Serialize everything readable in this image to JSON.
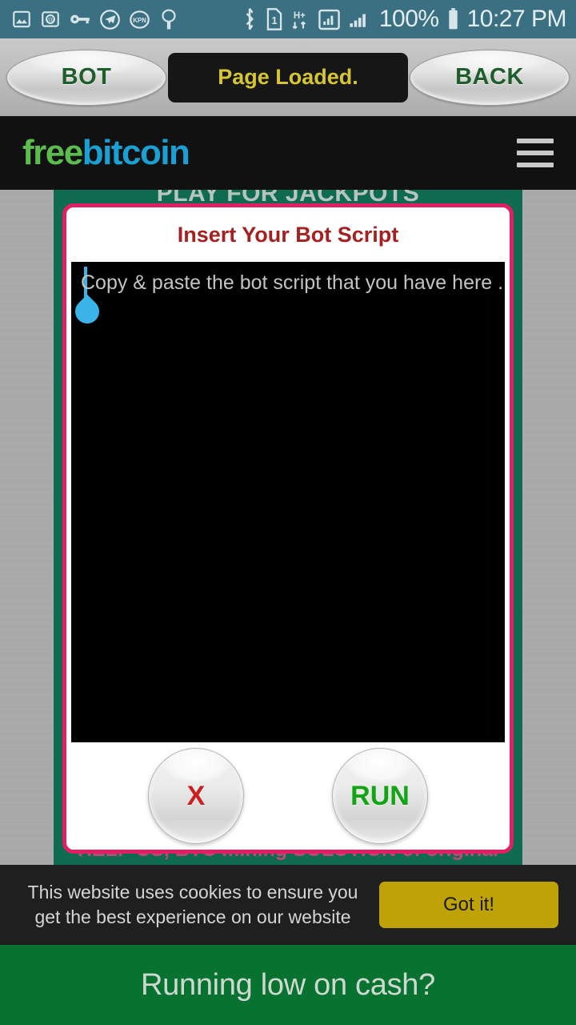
{
  "status_bar": {
    "left_icons": [
      {
        "name": "photo-icon",
        "glyph": "image"
      },
      {
        "name": "email-at-icon",
        "glyph": "at"
      },
      {
        "name": "vpn-key-icon",
        "glyph": "key"
      },
      {
        "name": "telegram-icon",
        "glyph": "paper-plane"
      },
      {
        "name": "kpn-icon",
        "glyph": "KPN"
      },
      {
        "name": "tree-icon",
        "glyph": "tree"
      }
    ],
    "right_icons": [
      {
        "name": "bluetooth-icon"
      },
      {
        "name": "sim-card-icon",
        "label": "1"
      },
      {
        "name": "hsplus-data-icon",
        "label": "H+"
      },
      {
        "name": "signal-sim1-icon"
      },
      {
        "name": "signal-sim2-icon"
      }
    ],
    "battery_percent": "100%",
    "clock": "10:27 PM"
  },
  "bot_bar": {
    "bot_label": "BOT",
    "status_message": "Page Loaded.",
    "back_label": "BACK"
  },
  "site_header": {
    "logo_part1": "free",
    "logo_part2": "bitcoin",
    "menu_name": "hamburger-menu-icon"
  },
  "page_background": {
    "jackpot_banner": "PLAY FOR JACKPOTS",
    "obscured_footer": "HELP US, BTC mining SOLUTION of original"
  },
  "dialog": {
    "title": "Insert Your Bot Script",
    "script_placeholder": "Copy & paste the bot script that you have here ...",
    "close_label": "X",
    "run_label": "RUN"
  },
  "cookie_banner": {
    "message": "This website uses cookies to ensure you get the best experience on our website",
    "accept_label": "Got it!"
  },
  "promo_banner": {
    "headline": "Running low on cash?"
  },
  "colors": {
    "status_bar_bg": "#3b7082",
    "dialog_border": "#e41e63",
    "dialog_title": "#a6201f",
    "logo_green": "#5cbc4d",
    "logo_blue": "#1ba0d4",
    "run_green": "#12a412",
    "close_red": "#cc2020",
    "cookie_button": "#bfa205",
    "promo_bg": "#087330",
    "panel_green": "#0e6b4f",
    "status_pill_text": "#d7c632"
  }
}
